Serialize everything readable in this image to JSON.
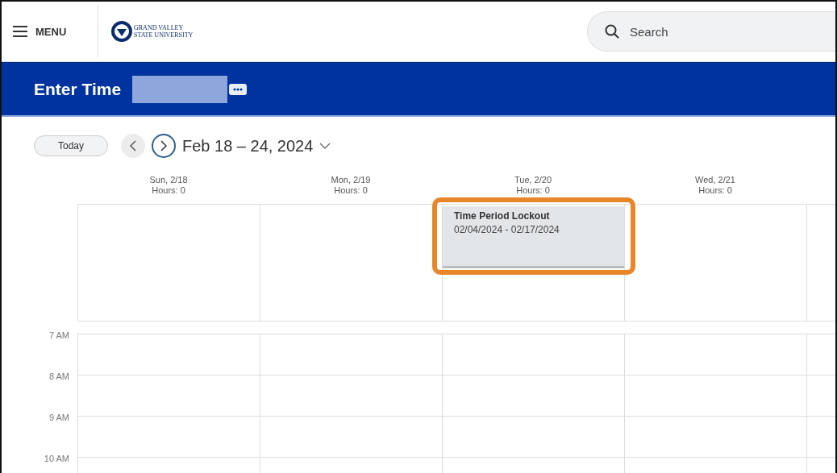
{
  "header": {
    "menu_label": "MENU",
    "logo_lines": [
      "GRAND VALLEY",
      "STATE UNIVERSITY"
    ],
    "search": {
      "placeholder": "Search"
    }
  },
  "page_title": "Enter Time",
  "toolbar": {
    "today": "Today",
    "range": "Feb 18 – 24, 2024"
  },
  "days": [
    {
      "date": "Sun, 2/18",
      "hours": "Hours: 0"
    },
    {
      "date": "Mon, 2/19",
      "hours": "Hours: 0"
    },
    {
      "date": "Tue, 2/20",
      "hours": "Hours: 0",
      "events": [
        {
          "title": "Time Period Lockout",
          "dates": "02/04/2024 - 02/17/2024",
          "highlighted": true
        }
      ]
    },
    {
      "date": "Wed, 2/21",
      "hours": "Hours: 0"
    }
  ],
  "time_slots": [
    "7 AM",
    "8 AM",
    "9 AM",
    "10 AM"
  ]
}
